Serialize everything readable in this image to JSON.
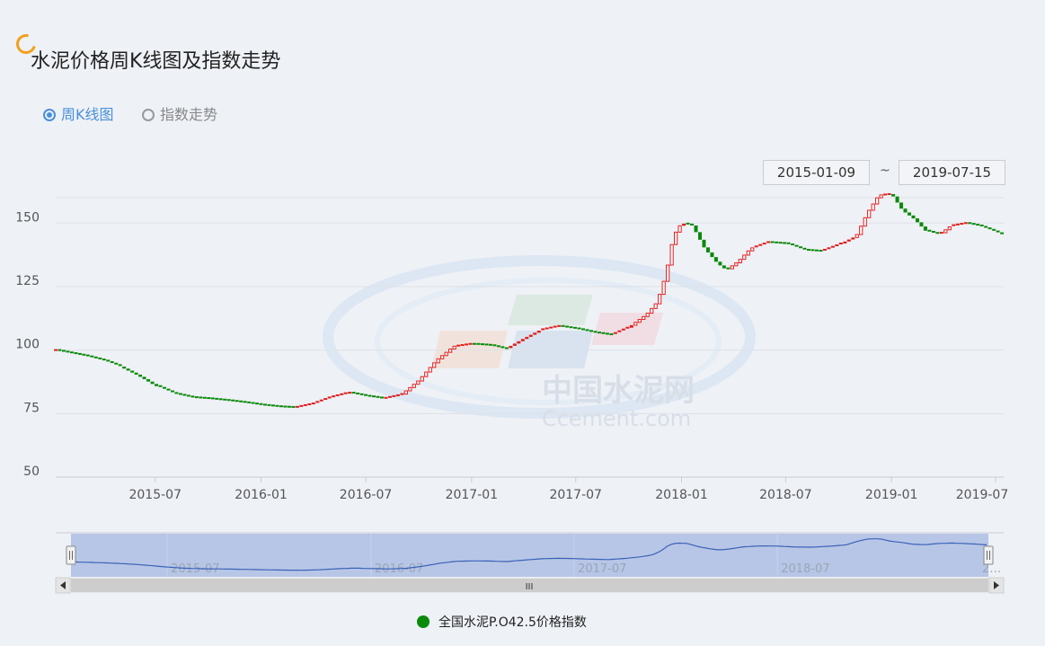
{
  "page": {
    "title": "水泥价格周K线图及指数走势",
    "radio_kline": "周K线图",
    "radio_index": "指数走势",
    "date_from": "2015-01-09",
    "date_sep": "~",
    "date_to": "2019-07-15",
    "watermark_cn": "中国水泥网",
    "watermark_en": "Ccement.com",
    "legend": "全国水泥P.O42.5价格指数",
    "scroll_grip": "III"
  },
  "colors": {
    "up": "#e02020",
    "down": "#0a8a0a",
    "accent": "#4a90d9",
    "navigator_fill": "#b7c6e6",
    "navigator_line": "#3a62b8"
  },
  "chart_data": {
    "type": "candlestick",
    "ylim": [
      50,
      160
    ],
    "yticks": [
      50,
      75,
      100,
      125,
      150
    ],
    "xrange": [
      "2015-01-09",
      "2019-07-15"
    ],
    "xticks": [
      "2015-07",
      "2016-01",
      "2016-07",
      "2017-01",
      "2017-07",
      "2018-01",
      "2018-07",
      "2019-01",
      "2019-07"
    ],
    "navigator_ticks": [
      "2015-07",
      "2016-07",
      "2017-07",
      "2018-07"
    ],
    "navigator_edge_label": "2…",
    "series": [
      {
        "name": "全国水泥P.O42.5价格指数",
        "points": [
          [
            "2015-01-09",
            100.0
          ],
          [
            "2015-02-01",
            99.0
          ],
          [
            "2015-03-01",
            97.8
          ],
          [
            "2015-04-01",
            96.0
          ],
          [
            "2015-05-01",
            93.5
          ],
          [
            "2015-06-01",
            90.0
          ],
          [
            "2015-07-01",
            86.0
          ],
          [
            "2015-08-01",
            83.0
          ],
          [
            "2015-09-01",
            81.5
          ],
          [
            "2015-10-01",
            81.0
          ],
          [
            "2015-11-01",
            80.3
          ],
          [
            "2015-12-01",
            79.5
          ],
          [
            "2016-01-01",
            78.5
          ],
          [
            "2016-02-01",
            77.8
          ],
          [
            "2016-03-01",
            77.5
          ],
          [
            "2016-04-01",
            79.0
          ],
          [
            "2016-05-01",
            81.5
          ],
          [
            "2016-06-01",
            83.3
          ],
          [
            "2016-07-01",
            82.0
          ],
          [
            "2016-08-01",
            81.0
          ],
          [
            "2016-09-01",
            82.5
          ],
          [
            "2016-10-01",
            88.0
          ],
          [
            "2016-11-01",
            96.0
          ],
          [
            "2016-12-01",
            101.5
          ],
          [
            "2017-01-01",
            102.5
          ],
          [
            "2017-02-01",
            102.0
          ],
          [
            "2017-03-01",
            100.5
          ],
          [
            "2017-04-01",
            104.5
          ],
          [
            "2017-05-01",
            108.0
          ],
          [
            "2017-06-01",
            109.5
          ],
          [
            "2017-07-01",
            108.5
          ],
          [
            "2017-08-01",
            107.0
          ],
          [
            "2017-09-01",
            106.0
          ],
          [
            "2017-10-01",
            109.0
          ],
          [
            "2017-11-01",
            114.0
          ],
          [
            "2017-11-20",
            119.0
          ],
          [
            "2017-12-05",
            130.0
          ],
          [
            "2017-12-18",
            145.0
          ],
          [
            "2018-01-01",
            150.0
          ],
          [
            "2018-01-20",
            149.0
          ],
          [
            "2018-02-10",
            140.0
          ],
          [
            "2018-03-05",
            134.0
          ],
          [
            "2018-03-20",
            131.5
          ],
          [
            "2018-04-10",
            135.0
          ],
          [
            "2018-05-01",
            140.0
          ],
          [
            "2018-06-01",
            142.5
          ],
          [
            "2018-07-01",
            142.0
          ],
          [
            "2018-08-01",
            139.5
          ],
          [
            "2018-09-01",
            139.0
          ],
          [
            "2018-10-01",
            141.5
          ],
          [
            "2018-11-01",
            145.0
          ],
          [
            "2018-11-20",
            154.0
          ],
          [
            "2018-12-10",
            161.0
          ],
          [
            "2019-01-01",
            161.5
          ],
          [
            "2019-01-20",
            155.0
          ],
          [
            "2019-02-10",
            151.5
          ],
          [
            "2019-03-01",
            147.0
          ],
          [
            "2019-03-25",
            145.5
          ],
          [
            "2019-04-15",
            149.0
          ],
          [
            "2019-05-10",
            150.0
          ],
          [
            "2019-06-01",
            149.0
          ],
          [
            "2019-06-25",
            147.0
          ],
          [
            "2019-07-15",
            145.0
          ]
        ]
      }
    ]
  }
}
